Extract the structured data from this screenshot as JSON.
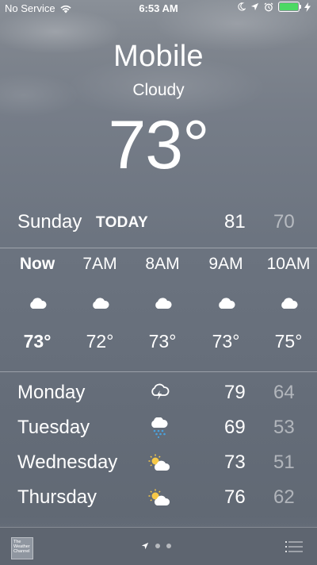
{
  "status_bar": {
    "carrier": "No Service",
    "time": "6:53 AM"
  },
  "location": {
    "city": "Mobile",
    "condition": "Cloudy",
    "temperature": "73°"
  },
  "today": {
    "day": "Sunday",
    "label": "TODAY",
    "high": "81",
    "low": "70"
  },
  "hourly": [
    {
      "hour": "Now",
      "icon": "cloud-icon",
      "temp": "73°"
    },
    {
      "hour": "7AM",
      "icon": "cloud-icon",
      "temp": "72°"
    },
    {
      "hour": "8AM",
      "icon": "cloud-icon",
      "temp": "73°"
    },
    {
      "hour": "9AM",
      "icon": "cloud-icon",
      "temp": "73°"
    },
    {
      "hour": "10AM",
      "icon": "cloud-icon",
      "temp": "75°"
    }
  ],
  "daily": [
    {
      "day": "Monday",
      "icon": "thunderstorm-icon",
      "high": "79",
      "low": "64"
    },
    {
      "day": "Tuesday",
      "icon": "rain-icon",
      "high": "69",
      "low": "53"
    },
    {
      "day": "Wednesday",
      "icon": "partly-cloudy-icon",
      "high": "73",
      "low": "51"
    },
    {
      "day": "Thursday",
      "icon": "partly-cloudy-icon",
      "high": "76",
      "low": "62"
    }
  ],
  "bottom_bar": {
    "logo_text": "The Weather Channel"
  },
  "colors": {
    "battery": "#4cd964",
    "rain_drops": "#4aa3df",
    "sun": "#f7c948"
  }
}
